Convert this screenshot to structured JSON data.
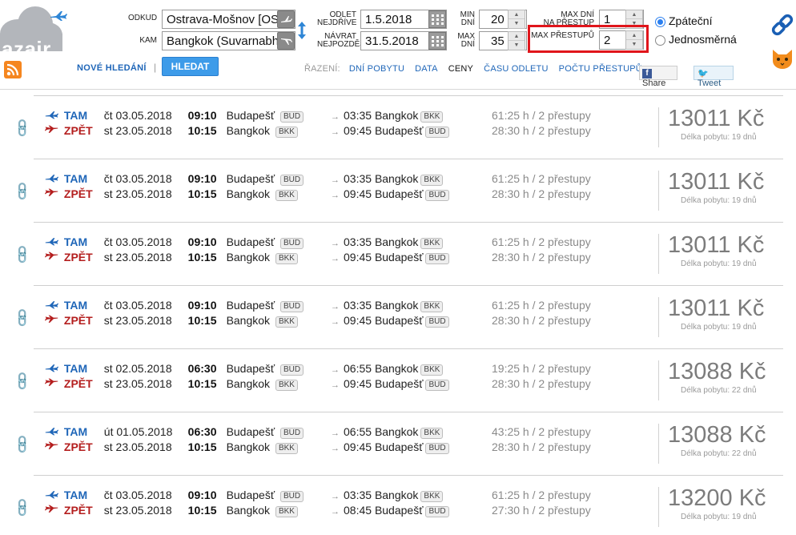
{
  "brand": {
    "logo_text": "azair"
  },
  "search": {
    "from_label": "ODKUD",
    "to_label": "KAM",
    "from_value": "Ostrava-Mošnov [OS",
    "to_value": "Bangkok (Suvarnabh",
    "depart_label_1": "ODLET",
    "depart_label_2": "NEJDŘÍVE",
    "return_label_1": "NÁVRAT",
    "return_label_2": "NEJPOZDĚJI",
    "depart_value": "1.5.2018",
    "return_value": "31.5.2018",
    "min_days_label_1": "MIN",
    "min_days_label_2": "DNÍ",
    "max_days_label_1": "MAX",
    "max_days_label_2": "DNÍ",
    "min_days_value": "20",
    "max_days_value": "35",
    "max_days_dest_label_1": "MAX DNÍ",
    "max_days_dest_label_2": "NA PŘESTUP",
    "max_days_dest_value": "1",
    "max_transfers_label": "MAX PŘESTUPŮ",
    "max_transfers_value": "2",
    "trip_type_options": [
      "Zpáteční",
      "Jednosměrná"
    ],
    "trip_type_selected": "Zpáteční",
    "new_search_label": "NOVÉ HLEDÁNÍ",
    "search_button_label": "HLEDAT"
  },
  "sorting": {
    "label": "ŘAZENÍ:",
    "options": [
      "DNÍ POBYTU",
      "DATA",
      "CENY",
      "ČASU ODLETU",
      "POČTU PŘESTUPŮ"
    ],
    "active": "CENY"
  },
  "social": {
    "share_label": "Share",
    "tweet_label": "Tweet"
  },
  "results": [
    {
      "out": {
        "label": "TAM",
        "date": "čt 03.05.2018",
        "time": "09:10",
        "from_city": "Budapešť",
        "from_code": "BUD",
        "arrive_time": "03:35",
        "to_city": "Bangkok",
        "to_code": "BKK",
        "duration": "61:25 h / 2 přestupy"
      },
      "ret": {
        "label": "ZPĚT",
        "date": "st 23.05.2018",
        "time": "10:15",
        "from_city": "Bangkok",
        "from_code": "BKK",
        "arrive_time": "09:45",
        "to_city": "Budapešť",
        "to_code": "BUD",
        "duration": "28:30 h / 2 přestupy"
      },
      "price": "13011 Kč",
      "stay": "Délka pobytu: 19 dnů"
    },
    {
      "out": {
        "label": "TAM",
        "date": "čt 03.05.2018",
        "time": "09:10",
        "from_city": "Budapešť",
        "from_code": "BUD",
        "arrive_time": "03:35",
        "to_city": "Bangkok",
        "to_code": "BKK",
        "duration": "61:25 h / 2 přestupy"
      },
      "ret": {
        "label": "ZPĚT",
        "date": "st 23.05.2018",
        "time": "10:15",
        "from_city": "Bangkok",
        "from_code": "BKK",
        "arrive_time": "09:45",
        "to_city": "Budapešť",
        "to_code": "BUD",
        "duration": "28:30 h / 2 přestupy"
      },
      "price": "13011 Kč",
      "stay": "Délka pobytu: 19 dnů"
    },
    {
      "out": {
        "label": "TAM",
        "date": "čt 03.05.2018",
        "time": "09:10",
        "from_city": "Budapešť",
        "from_code": "BUD",
        "arrive_time": "03:35",
        "to_city": "Bangkok",
        "to_code": "BKK",
        "duration": "61:25 h / 2 přestupy"
      },
      "ret": {
        "label": "ZPĚT",
        "date": "st 23.05.2018",
        "time": "10:15",
        "from_city": "Bangkok",
        "from_code": "BKK",
        "arrive_time": "09:45",
        "to_city": "Budapešť",
        "to_code": "BUD",
        "duration": "28:30 h / 2 přestupy"
      },
      "price": "13011 Kč",
      "stay": "Délka pobytu: 19 dnů"
    },
    {
      "out": {
        "label": "TAM",
        "date": "čt 03.05.2018",
        "time": "09:10",
        "from_city": "Budapešť",
        "from_code": "BUD",
        "arrive_time": "03:35",
        "to_city": "Bangkok",
        "to_code": "BKK",
        "duration": "61:25 h / 2 přestupy"
      },
      "ret": {
        "label": "ZPĚT",
        "date": "st 23.05.2018",
        "time": "10:15",
        "from_city": "Bangkok",
        "from_code": "BKK",
        "arrive_time": "09:45",
        "to_city": "Budapešť",
        "to_code": "BUD",
        "duration": "28:30 h / 2 přestupy"
      },
      "price": "13011 Kč",
      "stay": "Délka pobytu: 19 dnů"
    },
    {
      "out": {
        "label": "TAM",
        "date": "st 02.05.2018",
        "time": "06:30",
        "from_city": "Budapešť",
        "from_code": "BUD",
        "arrive_time": "06:55",
        "to_city": "Bangkok",
        "to_code": "BKK",
        "duration": "19:25 h / 2 přestupy"
      },
      "ret": {
        "label": "ZPĚT",
        "date": "st 23.05.2018",
        "time": "10:15",
        "from_city": "Bangkok",
        "from_code": "BKK",
        "arrive_time": "09:45",
        "to_city": "Budapešť",
        "to_code": "BUD",
        "duration": "28:30 h / 2 přestupy"
      },
      "price": "13088 Kč",
      "stay": "Délka pobytu: 22 dnů"
    },
    {
      "out": {
        "label": "TAM",
        "date": "út 01.05.2018",
        "time": "06:30",
        "from_city": "Budapešť",
        "from_code": "BUD",
        "arrive_time": "06:55",
        "to_city": "Bangkok",
        "to_code": "BKK",
        "duration": "43:25 h / 2 přestupy"
      },
      "ret": {
        "label": "ZPĚT",
        "date": "st 23.05.2018",
        "time": "10:15",
        "from_city": "Bangkok",
        "from_code": "BKK",
        "arrive_time": "09:45",
        "to_city": "Budapešť",
        "to_code": "BUD",
        "duration": "28:30 h / 2 přestupy"
      },
      "price": "13088 Kč",
      "stay": "Délka pobytu: 22 dnů"
    },
    {
      "out": {
        "label": "TAM",
        "date": "čt 03.05.2018",
        "time": "09:10",
        "from_city": "Budapešť",
        "from_code": "BUD",
        "arrive_time": "03:35",
        "to_city": "Bangkok",
        "to_code": "BKK",
        "duration": "61:25 h / 2 přestupy"
      },
      "ret": {
        "label": "ZPĚT",
        "date": "st 23.05.2018",
        "time": "10:15",
        "from_city": "Bangkok",
        "from_code": "BKK",
        "arrive_time": "08:45",
        "to_city": "Budapešť",
        "to_code": "BUD",
        "duration": "27:30 h / 2 přestupy"
      },
      "price": "13200 Kč",
      "stay": "Délka pobytu: 19 dnů"
    }
  ],
  "colors": {
    "accent_blue": "#1f66b8",
    "return_red": "#b41e1e",
    "highlight_box": "#e0151b",
    "search_button": "#3d9be9"
  },
  "icons": {
    "outbound": "plane-takeoff-icon",
    "return": "plane-landing-icon",
    "link": "chain-link-icon",
    "swap": "swap-arrows-icon",
    "calendar": "calendar-icon",
    "rss": "rss-icon",
    "cat": "cat-icon"
  }
}
